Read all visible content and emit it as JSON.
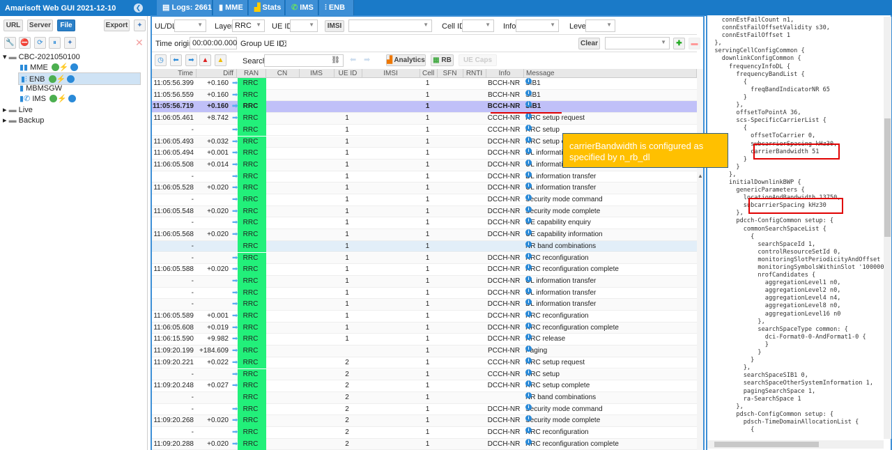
{
  "app": {
    "title": "Amarisoft Web GUI 2021-12-10"
  },
  "sidebar": {
    "buttons": {
      "url": "URL",
      "server": "Server",
      "file": "File",
      "export": "Export"
    },
    "tree": [
      {
        "label": "CBC-2021050100"
      },
      {
        "label": "MME"
      },
      {
        "label": "ENB"
      },
      {
        "label": "MBMSGW"
      },
      {
        "label": "IMS"
      },
      {
        "label": "Live"
      },
      {
        "label": "Backup"
      }
    ]
  },
  "tabs": [
    {
      "label": "Logs: 2661"
    },
    {
      "label": "MME"
    },
    {
      "label": "Stats"
    },
    {
      "label": "IMS"
    },
    {
      "label": "ENB"
    }
  ],
  "filters": {
    "uldl": "UL/DL",
    "layer": "Layer",
    "layer_value": "RRC",
    "ueid": "UE ID",
    "imsi": "IMSI",
    "cellid": "Cell ID",
    "info": "Info",
    "level": "Level",
    "time_origin": "Time origin:",
    "time_origin_value": "00:00:00.000",
    "group_ue": "Group UE ID:",
    "clear": "Clear",
    "search": "Search",
    "analytics": "Analytics",
    "rb": "RB",
    "uecaps": "UE Caps"
  },
  "table": {
    "columns": [
      "Time",
      "Diff",
      "RAN",
      "CN",
      "IMS",
      "UE ID",
      "IMSI",
      "Cell",
      "SFN",
      "RNTI",
      "Info",
      "Message"
    ],
    "selected_row": 2,
    "rows": [
      [
        "11:05:56.399",
        "+0.160",
        "RRC",
        "",
        "1",
        "BCCH-NR",
        "SIB1"
      ],
      [
        "11:05:56.559",
        "+0.160",
        "RRC",
        "",
        "1",
        "BCCH-NR",
        "SIB1"
      ],
      [
        "11:05:56.719",
        "+0.160",
        "RRC",
        "",
        "1",
        "BCCH-NR",
        "SIB1"
      ],
      [
        "11:06:05.461",
        "+8.742",
        "RRC",
        "1",
        "1",
        "CCCH-NR",
        "RRC setup request"
      ],
      [
        "-",
        "",
        "RRC",
        "1",
        "1",
        "CCCH-NR",
        "RRC setup"
      ],
      [
        "11:06:05.493",
        "+0.032",
        "RRC",
        "1",
        "1",
        "DCCH-NR",
        "RRC setup complete"
      ],
      [
        "11:06:05.494",
        "+0.001",
        "RRC",
        "1",
        "1",
        "DCCH-NR",
        "DL information transfer"
      ],
      [
        "11:06:05.508",
        "+0.014",
        "RRC",
        "1",
        "1",
        "DCCH-NR",
        "UL information transfer"
      ],
      [
        "-",
        "",
        "RRC",
        "1",
        "1",
        "DCCH-NR",
        "DL information transfer"
      ],
      [
        "11:06:05.528",
        "+0.020",
        "RRC",
        "1",
        "1",
        "DCCH-NR",
        "UL information transfer"
      ],
      [
        "-",
        "",
        "RRC",
        "1",
        "1",
        "DCCH-NR",
        "Security mode command"
      ],
      [
        "11:06:05.548",
        "+0.020",
        "RRC",
        "1",
        "1",
        "DCCH-NR",
        "Security mode complete"
      ],
      [
        "-",
        "",
        "RRC",
        "1",
        "1",
        "DCCH-NR",
        "UE capability enquiry"
      ],
      [
        "11:06:05.568",
        "+0.020",
        "RRC",
        "1",
        "1",
        "DCCH-NR",
        "UE capability information"
      ],
      [
        "-",
        "",
        "RRC",
        "1",
        "1",
        "",
        "NR band combinations"
      ],
      [
        "-",
        "",
        "RRC",
        "1",
        "1",
        "DCCH-NR",
        "RRC reconfiguration"
      ],
      [
        "11:06:05.588",
        "+0.020",
        "RRC",
        "1",
        "1",
        "DCCH-NR",
        "RRC reconfiguration complete"
      ],
      [
        "-",
        "",
        "RRC",
        "1",
        "1",
        "DCCH-NR",
        "UL information transfer"
      ],
      [
        "-",
        "",
        "RRC",
        "1",
        "1",
        "DCCH-NR",
        "UL information transfer"
      ],
      [
        "-",
        "",
        "RRC",
        "1",
        "1",
        "DCCH-NR",
        "DL information transfer"
      ],
      [
        "11:06:05.589",
        "+0.001",
        "RRC",
        "1",
        "1",
        "DCCH-NR",
        "RRC reconfiguration"
      ],
      [
        "11:06:05.608",
        "+0.019",
        "RRC",
        "1",
        "1",
        "DCCH-NR",
        "RRC reconfiguration complete"
      ],
      [
        "11:06:15.590",
        "+9.982",
        "RRC",
        "1",
        "1",
        "DCCH-NR",
        "RRC release"
      ],
      [
        "11:09:20.199",
        "+184.609",
        "RRC",
        "",
        "1",
        "PCCH-NR",
        "Paging"
      ],
      [
        "11:09:20.221",
        "+0.022",
        "RRC",
        "2",
        "1",
        "CCCH-NR",
        "RRC setup request"
      ],
      [
        "-",
        "",
        "RRC",
        "2",
        "1",
        "CCCH-NR",
        "RRC setup"
      ],
      [
        "11:09:20.248",
        "+0.027",
        "RRC",
        "2",
        "1",
        "DCCH-NR",
        "RRC setup complete"
      ],
      [
        "-",
        "",
        "RRC",
        "2",
        "1",
        "",
        "NR band combinations"
      ],
      [
        "-",
        "",
        "RRC",
        "2",
        "1",
        "DCCH-NR",
        "Security mode command"
      ],
      [
        "11:09:20.268",
        "+0.020",
        "RRC",
        "2",
        "1",
        "DCCH-NR",
        "Security mode complete"
      ],
      [
        "-",
        "",
        "RRC",
        "2",
        "1",
        "DCCH-NR",
        "RRC reconfiguration"
      ],
      [
        "11:09:20.288",
        "+0.020",
        "RRC",
        "2",
        "1",
        "DCCH-NR",
        "RRC reconfiguration complete"
      ]
    ]
  },
  "detail": {
    "lines": [
      "    connEstFailCount n1,",
      "    connEstFailOffsetValidity s30,",
      "    connEstFailOffset 1",
      "  },",
      "  servingCellConfigCommon {",
      "    downlinkConfigCommon {",
      "      frequencyInfoDL {",
      "        frequencyBandList {",
      "          {",
      "            freqBandIndicatorNR 65",
      "          }",
      "        },",
      "        offsetToPointA 36,",
      "        scs-SpecificCarrierList {",
      "          {",
      "            offsetToCarrier 0,",
      "            subcarrierSpacing kHz30,",
      "            carrierBandwidth 51",
      "          }",
      "        }",
      "      },",
      "      initialDownlinkBWP {",
      "        genericParameters {",
      "          locationAndBandwidth 13750,",
      "          subcarrierSpacing kHz30",
      "        },",
      "        pdcch-ConfigCommon setup: {",
      "          commonSearchSpaceList {",
      "            {",
      "              searchSpaceId 1,",
      "              controlResourceSetId 0,",
      "              monitoringSlotPeriodicityAndOffset s",
      "              monitoringSymbolsWithinSlot '1000000",
      "              nrofCandidates {",
      "                aggregationLevel1 n0,",
      "                aggregationLevel2 n0,",
      "                aggregationLevel4 n4,",
      "                aggregationLevel8 n0,",
      "                aggregationLevel16 n0",
      "              },",
      "              searchSpaceType common: {",
      "                dci-Format0-0-AndFormat1-0 {",
      "                }",
      "              }",
      "            }",
      "          },",
      "          searchSpaceSIB1 0,",
      "          searchSpaceOtherSystemInformation 1,",
      "          pagingSearchSpace 1,",
      "          ra-SearchSpace 1",
      "        },",
      "        pdsch-ConfigCommon setup: {",
      "          pdsch-TimeDomainAllocationList {",
      "            {"
    ]
  },
  "annotation": {
    "text": "carrierBandwidth is configured as specified by n_rb_dl"
  },
  "colors": {
    "brand": "#1a7ac8",
    "ran_rrc": "#22f07a",
    "selected_row": "#c0c0f8",
    "callout": "#ffc000",
    "highlight": "#e00000"
  }
}
